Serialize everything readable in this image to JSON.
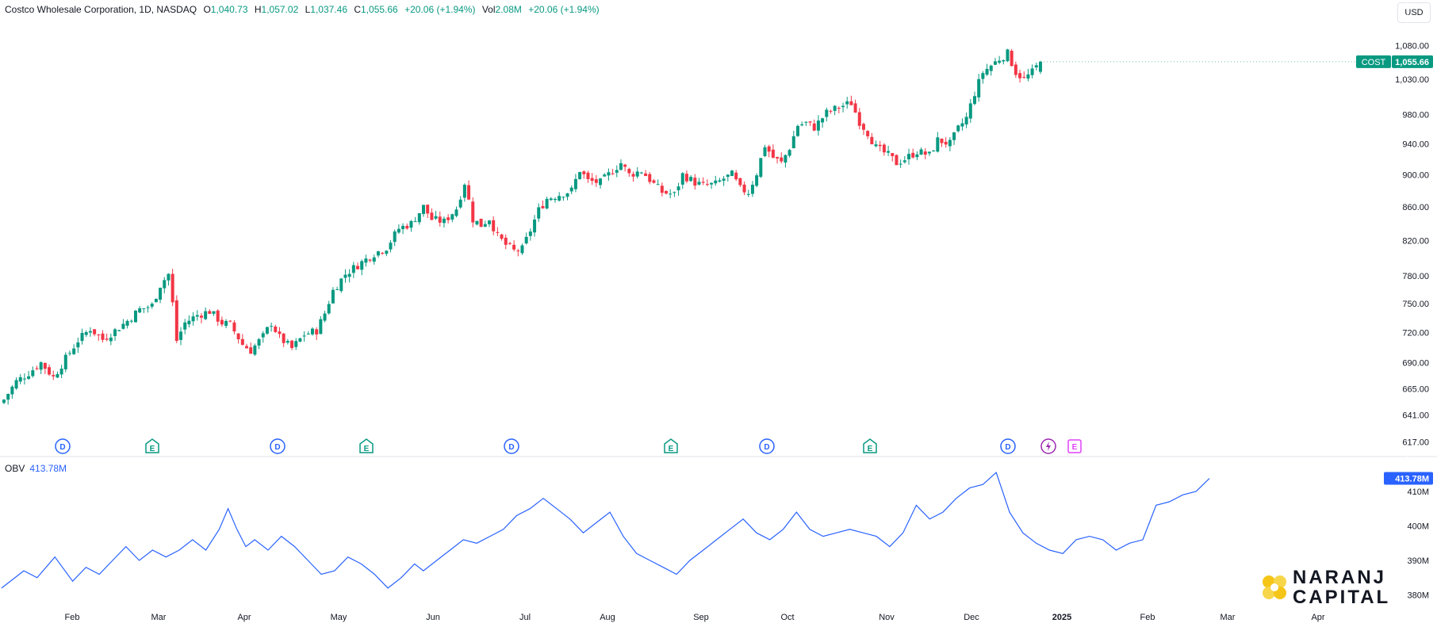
{
  "header": {
    "symbol_desc": "Costco Wholesale Corporation, 1D, NASDAQ",
    "open_label": "O",
    "open": "1,040.73",
    "high_label": "H",
    "high": "1,057.02",
    "low_label": "L",
    "low": "1,037.46",
    "close_label": "C",
    "close": "1,055.66",
    "change": "+20.06 (+1.94%)",
    "vol_label": "Vol",
    "vol": "2.08M",
    "vol_change": "+20.06 (+1.94%)"
  },
  "currency_button": "USD",
  "price_tag": {
    "symbol": "COST",
    "value": "1,055.66"
  },
  "obv": {
    "label": "OBV",
    "value": "413.78M"
  },
  "logo": {
    "line1": "NARANJ",
    "line2": "CAPITAL"
  },
  "colors": {
    "up": "#089981",
    "down": "#f23645",
    "obv_line": "#2962ff",
    "grid": "#f0f3fa",
    "dividend": "#2962ff",
    "earnings": "#089981",
    "split": "#9c27b0",
    "earnings_future": "#e040fb"
  },
  "chart_data": [
    {
      "type": "candlestick",
      "title": "Costco Wholesale Corporation, 1D, NASDAQ",
      "x_ticks": [
        "Feb",
        "Mar",
        "Apr",
        "May",
        "Jun",
        "Jul",
        "Aug",
        "Sep",
        "Oct",
        "Nov",
        "Dec",
        "2025",
        "Feb",
        "Mar",
        "Apr"
      ],
      "y_ticks": [
        "617.00",
        "641.00",
        "665.00",
        "690.00",
        "720.00",
        "750.00",
        "780.00",
        "820.00",
        "860.00",
        "900.00",
        "940.00",
        "980.00",
        "1,030.00",
        "1,080.00"
      ],
      "scale": "log",
      "ylim": [
        605,
        1120
      ],
      "close_series": [
        [
          0,
          655
        ],
        [
          3,
          672
        ],
        [
          6,
          680
        ],
        [
          9,
          690
        ],
        [
          12,
          676
        ],
        [
          15,
          694
        ],
        [
          18,
          712
        ],
        [
          21,
          724
        ],
        [
          24,
          713
        ],
        [
          27,
          722
        ],
        [
          30,
          732
        ],
        [
          33,
          744
        ],
        [
          36,
          748
        ],
        [
          38,
          770
        ],
        [
          40,
          782
        ],
        [
          41,
          750
        ],
        [
          42,
          712
        ],
        [
          44,
          730
        ],
        [
          47,
          738
        ],
        [
          50,
          742
        ],
        [
          53,
          730
        ],
        [
          55,
          728
        ],
        [
          58,
          708
        ],
        [
          60,
          702
        ],
        [
          63,
          716
        ],
        [
          65,
          730
        ],
        [
          67,
          715
        ],
        [
          70,
          704
        ],
        [
          73,
          718
        ],
        [
          76,
          722
        ],
        [
          78,
          740
        ],
        [
          80,
          764
        ],
        [
          83,
          782
        ],
        [
          86,
          792
        ],
        [
          90,
          805
        ],
        [
          93,
          812
        ],
        [
          96,
          834
        ],
        [
          99,
          840
        ],
        [
          102,
          860
        ],
        [
          104,
          845
        ],
        [
          107,
          842
        ],
        [
          110,
          858
        ],
        [
          112,
          890
        ],
        [
          114,
          845
        ],
        [
          116,
          838
        ],
        [
          118,
          846
        ],
        [
          120,
          825
        ],
        [
          122,
          815
        ],
        [
          124,
          808
        ],
        [
          126,
          810
        ],
        [
          128,
          832
        ],
        [
          130,
          856
        ],
        [
          132,
          870
        ],
        [
          135,
          875
        ],
        [
          138,
          880
        ],
        [
          140,
          906
        ],
        [
          142,
          892
        ],
        [
          145,
          890
        ],
        [
          148,
          905
        ],
        [
          150,
          915
        ],
        [
          152,
          900
        ],
        [
          155,
          905
        ],
        [
          158,
          888
        ],
        [
          160,
          878
        ],
        [
          163,
          875
        ],
        [
          165,
          900
        ],
        [
          168,
          890
        ],
        [
          170,
          886
        ],
        [
          173,
          888
        ],
        [
          175,
          895
        ],
        [
          177,
          900
        ],
        [
          179,
          882
        ],
        [
          181,
          878
        ],
        [
          183,
          902
        ],
        [
          185,
          938
        ],
        [
          187,
          922
        ],
        [
          189,
          915
        ],
        [
          191,
          935
        ],
        [
          193,
          965
        ],
        [
          195,
          968
        ],
        [
          197,
          962
        ],
        [
          200,
          982
        ],
        [
          203,
          990
        ],
        [
          206,
          996
        ],
        [
          208,
          970
        ],
        [
          210,
          955
        ],
        [
          212,
          935
        ],
        [
          215,
          925
        ],
        [
          217,
          915
        ],
        [
          219,
          920
        ],
        [
          222,
          930
        ],
        [
          225,
          925
        ],
        [
          227,
          945
        ],
        [
          230,
          940
        ],
        [
          232,
          960
        ],
        [
          234,
          975
        ],
        [
          236,
          1010
        ],
        [
          238,
          1040
        ],
        [
          240,
          1050
        ],
        [
          242,
          1060
        ],
        [
          244,
          1068
        ],
        [
          246,
          1040
        ],
        [
          248,
          1030
        ],
        [
          250,
          1040
        ],
        [
          252,
          1055.66
        ]
      ],
      "last_index": 252,
      "total_slots": 295
    },
    {
      "type": "line",
      "series": [
        {
          "name": "OBV"
        }
      ],
      "y_ticks": [
        "380M",
        "390M",
        "400M",
        "410M"
      ],
      "ylim": [
        376,
        415.5
      ],
      "values_series": [
        [
          0,
          382
        ],
        [
          5,
          387
        ],
        [
          8,
          385
        ],
        [
          12,
          391
        ],
        [
          16,
          384
        ],
        [
          19,
          388
        ],
        [
          22,
          386
        ],
        [
          25,
          390
        ],
        [
          28,
          394
        ],
        [
          31,
          390
        ],
        [
          34,
          393
        ],
        [
          37,
          391
        ],
        [
          40,
          393
        ],
        [
          43,
          396
        ],
        [
          46,
          393
        ],
        [
          49,
          399
        ],
        [
          51,
          405
        ],
        [
          53,
          399
        ],
        [
          55,
          394
        ],
        [
          57,
          396
        ],
        [
          60,
          393
        ],
        [
          63,
          397
        ],
        [
          66,
          394
        ],
        [
          69,
          390
        ],
        [
          72,
          386
        ],
        [
          75,
          387
        ],
        [
          78,
          391
        ],
        [
          81,
          389
        ],
        [
          84,
          386
        ],
        [
          87,
          382
        ],
        [
          90,
          385
        ],
        [
          93,
          389
        ],
        [
          95,
          387
        ],
        [
          98,
          390
        ],
        [
          101,
          393
        ],
        [
          104,
          396
        ],
        [
          107,
          395
        ],
        [
          110,
          397
        ],
        [
          113,
          399
        ],
        [
          116,
          403
        ],
        [
          119,
          405
        ],
        [
          122,
          408
        ],
        [
          125,
          405
        ],
        [
          128,
          402
        ],
        [
          131,
          398
        ],
        [
          134,
          401
        ],
        [
          137,
          404
        ],
        [
          140,
          397
        ],
        [
          143,
          392
        ],
        [
          146,
          390
        ],
        [
          149,
          388
        ],
        [
          152,
          386
        ],
        [
          155,
          390
        ],
        [
          158,
          393
        ],
        [
          161,
          396
        ],
        [
          164,
          399
        ],
        [
          167,
          402
        ],
        [
          170,
          398
        ],
        [
          173,
          396
        ],
        [
          176,
          399
        ],
        [
          179,
          404
        ],
        [
          182,
          399
        ],
        [
          185,
          397
        ],
        [
          188,
          398
        ],
        [
          191,
          399
        ],
        [
          194,
          398
        ],
        [
          197,
          397
        ],
        [
          200,
          394
        ],
        [
          203,
          398
        ],
        [
          206,
          406
        ],
        [
          209,
          402
        ],
        [
          212,
          404
        ],
        [
          215,
          408
        ],
        [
          218,
          411
        ],
        [
          221,
          412
        ],
        [
          224,
          415.5
        ],
        [
          227,
          404
        ],
        [
          230,
          398
        ],
        [
          233,
          395
        ],
        [
          236,
          393
        ],
        [
          239,
          392
        ],
        [
          242,
          396
        ],
        [
          245,
          397
        ],
        [
          248,
          396
        ],
        [
          251,
          393
        ],
        [
          254,
          395
        ],
        [
          257,
          396
        ],
        [
          260,
          406
        ],
        [
          263,
          407
        ],
        [
          266,
          409
        ],
        [
          269,
          410
        ],
        [
          272,
          413.78
        ]
      ]
    }
  ],
  "events": [
    {
      "type": "D",
      "pos": 79
    },
    {
      "type": "E",
      "pos": 192
    },
    {
      "type": "D",
      "pos": 350
    },
    {
      "type": "E",
      "pos": 462
    },
    {
      "type": "D",
      "pos": 645
    },
    {
      "type": "E",
      "pos": 846
    },
    {
      "type": "D",
      "pos": 967
    },
    {
      "type": "E",
      "pos": 1097
    },
    {
      "type": "D",
      "pos": 1271
    },
    {
      "type": "S",
      "pos": 1322
    },
    {
      "type": "F",
      "pos": 1355
    }
  ]
}
